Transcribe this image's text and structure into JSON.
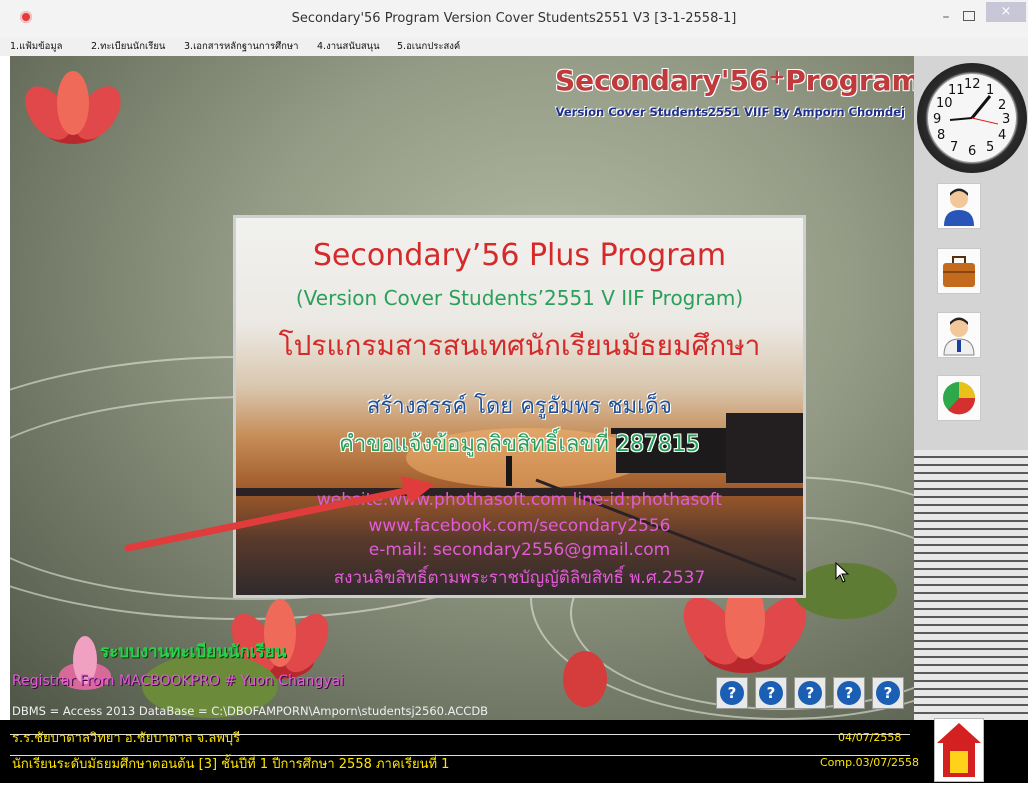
{
  "window": {
    "title": "Secondary'56 Program Version Cover Students2551 V3 [3-1-2558-1]",
    "minimize": "–",
    "close": "×"
  },
  "menu": [
    "1.แฟ้มข้อมูล",
    "2.ทะเบียนนักเรียน",
    "3.เอกสารหลักฐานการศึกษา",
    "4.งานสนับสนุน",
    "5.อเนกประสงค์"
  ],
  "banner": {
    "title": "Secondary'56",
    "plus": "+",
    "program": "Program",
    "subtitle": "Version Cover Students2551 VIIF By Amporn Chomdej"
  },
  "clock": {
    "numbers": [
      "12",
      "1",
      "2",
      "3",
      "4",
      "5",
      "6",
      "7",
      "8",
      "9",
      "10",
      "11"
    ]
  },
  "splash": {
    "title": "Secondary’56 Plus Program",
    "version": "(Version Cover Students’2551 V IIF Program)",
    "thai_name": "โปรแกรมสารสนเทศนักเรียนมัธยมศึกษา",
    "creator": "สร้างสรรค์ โดย ครูอัมพร  ชมเด็จ",
    "copyright_no": "คำขอแจ้งข้อมูลลิขสิทธิ์เลขที่ 287815",
    "website": "website:www.phothasoft.com line-id:phothasoft",
    "facebook": "www.facebook.com/secondary2556",
    "email": "e-mail: secondary2556@gmail.com",
    "rights": "สงวนลิขสิทธิ์ตามพระราชบัญญัติลิขสิทธิ์ พ.ศ.2537"
  },
  "system_name": "ระบบงานทะเบียนนักเรียน",
  "registrar": "Registrar From MACBOOKPRO # Yuon  Changyai",
  "dbms": "DBMS = Access 2013  DataBase = C:\\DBOFAMPORN\\Amporn\\studentsj2560.ACCDB",
  "help_buttons": [
    "?",
    "?",
    "?",
    "?",
    "?"
  ],
  "status": {
    "school": "ร.ร.ชัยบาดาลวิทยา  อ.ชัยบาดาล  จ.ลพบุรี",
    "date": "04/07/2558",
    "level": "นักเรียนระดับมัธยมศึกษาตอนต้น [3]  ชั้นปีที่ 1  ปีการศึกษา 2558  ภาคเรียนที่  1",
    "comp": "Comp.03/07/2558"
  },
  "colors": {
    "banner_red": "#c0393b",
    "banner_blue": "#1e2f8c",
    "splash_title": "#d42a2a",
    "splash_green": "#2aa05a",
    "splash_pink": "#e25bd8",
    "status_yellow": "#ffe600",
    "system_green": "#28d24a"
  }
}
